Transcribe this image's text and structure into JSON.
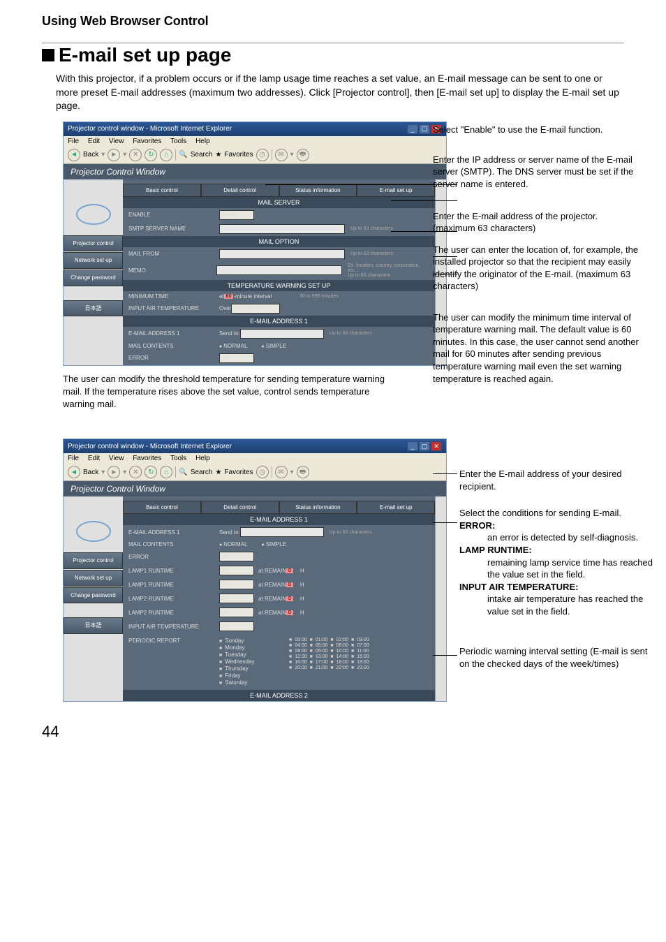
{
  "page": {
    "section_header": "Using Web Browser Control",
    "title": "E-mail set up page",
    "intro": "With this projector, if a problem occurs or if the lamp usage time reaches a set value, an E-mail message can be sent to one or more preset E-mail addresses (maximum two addresses). Click [Projector control], then [E-mail set up] to display the E-mail set up page.",
    "page_number": "44"
  },
  "browser": {
    "title": "Projector control window - Microsoft Internet Explorer",
    "menu": [
      "File",
      "Edit",
      "View",
      "Favorites",
      "Tools",
      "Help"
    ],
    "toolbar": {
      "back": "Back",
      "search": "Search",
      "favorites": "Favorites"
    },
    "content_title": "Projector Control Window",
    "sidebar": [
      "Projector control",
      "Network set up",
      "Change password",
      "日本語"
    ],
    "tabs": [
      "Basic control",
      "Detail control",
      "Status information",
      "E-mail set up"
    ]
  },
  "form1": {
    "sections": {
      "mail_server": "MAIL SERVER",
      "mail_option": "MAIL OPTION",
      "temp_warn": "TEMPERATURE WARNING SET UP",
      "addr1": "E-MAIL ADDRESS 1"
    },
    "labels": {
      "enable": "ENABLE",
      "smtp": "SMTP SERVER NAME",
      "mail_from": "MAIL FROM",
      "memo": "MEMO",
      "min_time": "MINIMUM TIME",
      "input_air": "INPUT AIR TEMPERATURE",
      "email1": "E-MAIL ADDRESS 1",
      "mail_contents": "MAIL CONTENTS",
      "error": "ERROR",
      "send_to": "Send to:",
      "normal": "NORMAL",
      "simple": "SIMPLE",
      "on": "ON",
      "disable": "Disable"
    },
    "notes": {
      "up63chars": "Up to 63 characters",
      "ex_loc": "Ex. location, country, corporation, etc...",
      "min_int": "-minute interval",
      "range_min": "30 to 999 minutes",
      "over": "Over",
      "tempval": "45° C/113° F",
      "at": "at",
      "num60": "60"
    }
  },
  "form2": {
    "sections": {
      "addr1": "E-MAIL ADDRESS 1",
      "addr2": "E-MAIL ADDRESS 2"
    },
    "labels": {
      "email1": "E-MAIL ADDRESS 1",
      "mail_contents": "MAIL CONTENTS",
      "error": "ERROR",
      "lamp1r": "LAMP1 RUNTIME",
      "lamp2r": "LAMP2 RUNTIME",
      "input_air": "INPUT AIR TEMPERATURE",
      "periodic": "PERIODIC REPORT",
      "send_to": "Send to:",
      "normal": "NORMAL",
      "simple": "SIMPLE",
      "off": "OFF",
      "at_remain": "at REMAIN",
      "h": "H",
      "num0": "0"
    },
    "notes": {
      "up63chars": "Up to 63 characters"
    },
    "days": [
      "Sunday",
      "Monday",
      "Tuesday",
      "Wednesday",
      "Thursday",
      "Friday",
      "Saturday"
    ],
    "times_rows": [
      [
        "00:00",
        "01:00",
        "02:00",
        "03:00"
      ],
      [
        "04:00",
        "05:00",
        "06:00",
        "07:00"
      ],
      [
        "08:00",
        "09:00",
        "10:00",
        "11:00"
      ],
      [
        "12:00",
        "13:00",
        "14:00",
        "15:00"
      ],
      [
        "16:00",
        "17:00",
        "18:00",
        "19:00"
      ],
      [
        "20:00",
        "21:00",
        "22:00",
        "23:00"
      ]
    ]
  },
  "annotations1": {
    "a1": "Select \"Enable\" to use the E-mail function.",
    "a2": "Enter the IP address or server name of the E-mail server (SMTP). The DNS server must be set if the server name is entered.",
    "a3": "Enter the E-mail address of the projector. (maximum 63 characters)",
    "a4": "The user can enter the location of, for example, the installed projector so that the recipient may easily identify the originator of the E-mail. (maximum 63 characters)",
    "a5": "The user can modify the minimum time interval of temperature warning mail.  The default value is 60 minutes.  In this case, the user cannot send another mail for 60 minutes after sending previous temperature warning mail even the set warning temperature is reached again.",
    "below": "The user can modify the threshold temperature for sending temperature warning mail. If the temperature rises above the set value, control sends temperature warning mail."
  },
  "annotations2": {
    "b1": "Enter the E-mail address of your desired recipient.",
    "b2": "Select the conditions for sending E-mail.",
    "b2_error_h": "ERROR:",
    "b2_error_t": "an error is detected by self-diagnosis.",
    "b2_lamp_h": "LAMP RUNTIME:",
    "b2_lamp_t": "remaining lamp service time has reached the value set in the field.",
    "b2_air_h": "INPUT AIR TEMPERATURE:",
    "b2_air_t": "intake air temperature has reached the value set in the field.",
    "b3": "Periodic warning interval setting (E-mail is sent on the checked days of the week/times)"
  }
}
